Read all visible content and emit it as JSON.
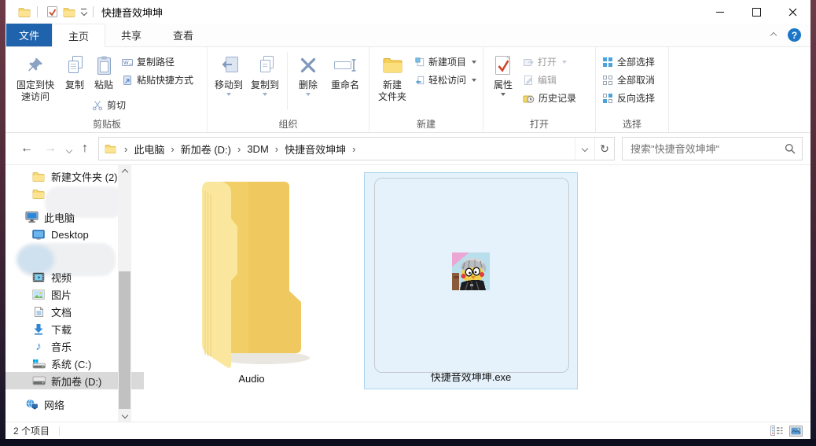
{
  "window": {
    "title": "快捷音效坤坤",
    "statusbar_count": "2 个项目"
  },
  "tabs": {
    "file": "文件",
    "home": "主页",
    "share": "共享",
    "view": "查看"
  },
  "ribbon": {
    "clipboard": {
      "group": "剪贴板",
      "pin": "固定到快\n速访问",
      "copy": "复制",
      "paste": "粘贴",
      "copy_path": "复制路径",
      "paste_shortcut": "粘贴快捷方式",
      "cut": "剪切"
    },
    "organize": {
      "group": "组织",
      "move_to": "移动到",
      "copy_to": "复制到",
      "del": "删除",
      "rename": "重命名"
    },
    "create": {
      "group": "新建",
      "new_folder": "新建\n文件夹",
      "new_item": "新建项目",
      "easy_access": "轻松访问"
    },
    "open": {
      "group": "打开",
      "properties": "属性",
      "open": "打开",
      "edit": "编辑",
      "history": "历史记录"
    },
    "select": {
      "group": "选择",
      "select_all": "全部选择",
      "select_none": "全部取消",
      "invert": "反向选择"
    }
  },
  "addressbar": {
    "crumbs": [
      "此电脑",
      "新加卷 (D:)",
      "3DM",
      "快捷音效坤坤"
    ],
    "search_placeholder": "搜索\"快捷音效坤坤\""
  },
  "sidebar": {
    "items": [
      {
        "label": "新建文件夹 (2)"
      },
      {
        "label": ""
      },
      {
        "label": "此电脑"
      },
      {
        "label": "Desktop"
      },
      {
        "label": ""
      },
      {
        "label": "视频"
      },
      {
        "label": "图片"
      },
      {
        "label": "文档"
      },
      {
        "label": "下载"
      },
      {
        "label": "音乐"
      },
      {
        "label": "系统 (C:)"
      },
      {
        "label": "新加卷 (D:)"
      },
      {
        "label": "网络"
      }
    ]
  },
  "files": [
    {
      "name": "Audio"
    },
    {
      "name": "快捷音效坤坤.exe"
    }
  ]
}
